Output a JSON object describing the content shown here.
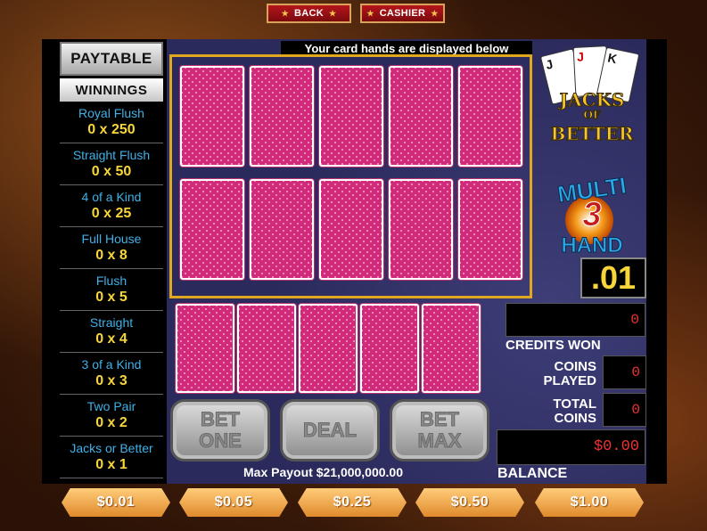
{
  "nav": {
    "back_label": "BACK",
    "cashier_label": "CASHIER"
  },
  "paytable": {
    "button_label": "PAYTABLE",
    "header": "WINNINGS",
    "rows": [
      {
        "name": "Royal Flush",
        "value": "0 x 250"
      },
      {
        "name": "Straight Flush",
        "value": "0 x 50"
      },
      {
        "name": "4 of a Kind",
        "value": "0 x 25"
      },
      {
        "name": "Full House",
        "value": "0 x 8"
      },
      {
        "name": "Flush",
        "value": "0 x 5"
      },
      {
        "name": "Straight",
        "value": "0 x 4"
      },
      {
        "name": "3 of a Kind",
        "value": "0 x 3"
      },
      {
        "name": "Two Pair",
        "value": "0 x 2"
      },
      {
        "name": "Jacks or Better",
        "value": "0 x 1"
      }
    ]
  },
  "hands_note": "Your card hands are displayed below",
  "logo": {
    "line1": "JACKS",
    "line2": "OF",
    "line3": "BETTER",
    "multi": "MULTI",
    "number": "3",
    "hand": "HAND",
    "card_j": "J",
    "card_j2": "J",
    "card_k": "K"
  },
  "denomination_display": ".01",
  "credits_won": {
    "label": "CREDITS WON",
    "value": "0"
  },
  "coins_played": {
    "label_1": "COINS",
    "label_2": "PLAYED",
    "value": "0"
  },
  "total_coins": {
    "label_1": "TOTAL",
    "label_2": "COINS",
    "value": "0"
  },
  "balance": {
    "label": "BALANCE",
    "value": "$0.00"
  },
  "buttons": {
    "bet_one_1": "BET",
    "bet_one_2": "ONE",
    "deal": "DEAL",
    "bet_max_1": "BET",
    "bet_max_2": "MAX"
  },
  "max_payout": "Max Payout $21,000,000.00",
  "denominations": [
    "$0.01",
    "$0.05",
    "$0.25",
    "$0.50",
    "$1.00"
  ],
  "colors": {
    "accent_gold": "#f8d63a",
    "label_blue": "#3fb1e8",
    "lcd_red": "#e33333",
    "frame_gold": "#e0a820"
  }
}
